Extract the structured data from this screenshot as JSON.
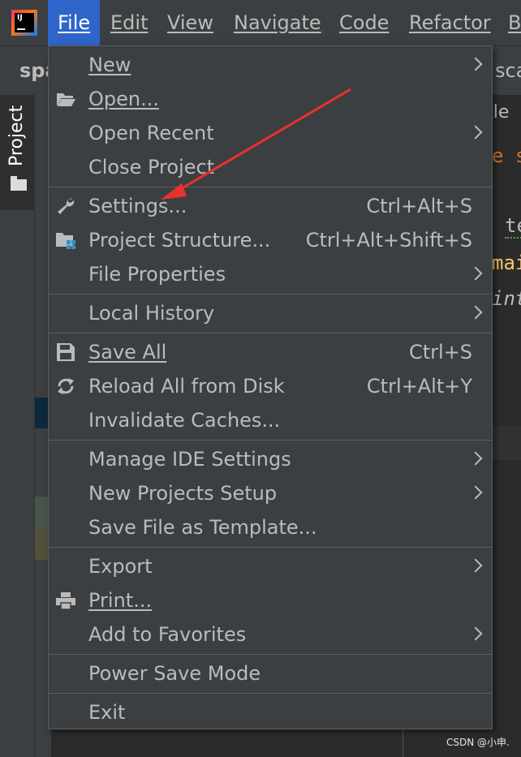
{
  "menubar": {
    "items": [
      "File",
      "Edit",
      "View",
      "Navigate",
      "Code",
      "Refactor",
      "B"
    ]
  },
  "toolbar": {
    "project_name": "spa",
    "right_tab": "scal"
  },
  "sidebar": {
    "project_tab_label": "Project"
  },
  "editor": {
    "tab": "rkle",
    "lines": [
      "e s",
      "te",
      "mai",
      "int"
    ]
  },
  "file_menu": {
    "items": {
      "new": "New",
      "open": "Open...",
      "open_recent": "Open Recent",
      "close_project": "Close Project",
      "settings": "Settings...",
      "settings_shortcut": "Ctrl+Alt+S",
      "project_structure": "Project Structure...",
      "project_structure_shortcut": "Ctrl+Alt+Shift+S",
      "file_properties": "File Properties",
      "local_history": "Local History",
      "save_all": "Save All",
      "save_all_shortcut": "Ctrl+S",
      "reload_all": "Reload All from Disk",
      "reload_all_shortcut": "Ctrl+Alt+Y",
      "invalidate_caches": "Invalidate Caches...",
      "manage_ide_settings": "Manage IDE Settings",
      "new_projects_setup": "New Projects Setup",
      "save_file_as_template": "Save File as Template...",
      "export": "Export",
      "print": "Print...",
      "add_to_favorites": "Add to Favorites",
      "power_save_mode": "Power Save Mode",
      "exit": "Exit"
    }
  },
  "watermark": "CSDN @小申.",
  "colors": {
    "menubar_bg": "#3c3f41",
    "active_menu_bg": "#2f65ca",
    "menu_text": "#bbbbbb",
    "arrow_annotation": "#e8322b",
    "editor_orange": "#cc7832",
    "editor_yellow": "#ffc66d"
  }
}
